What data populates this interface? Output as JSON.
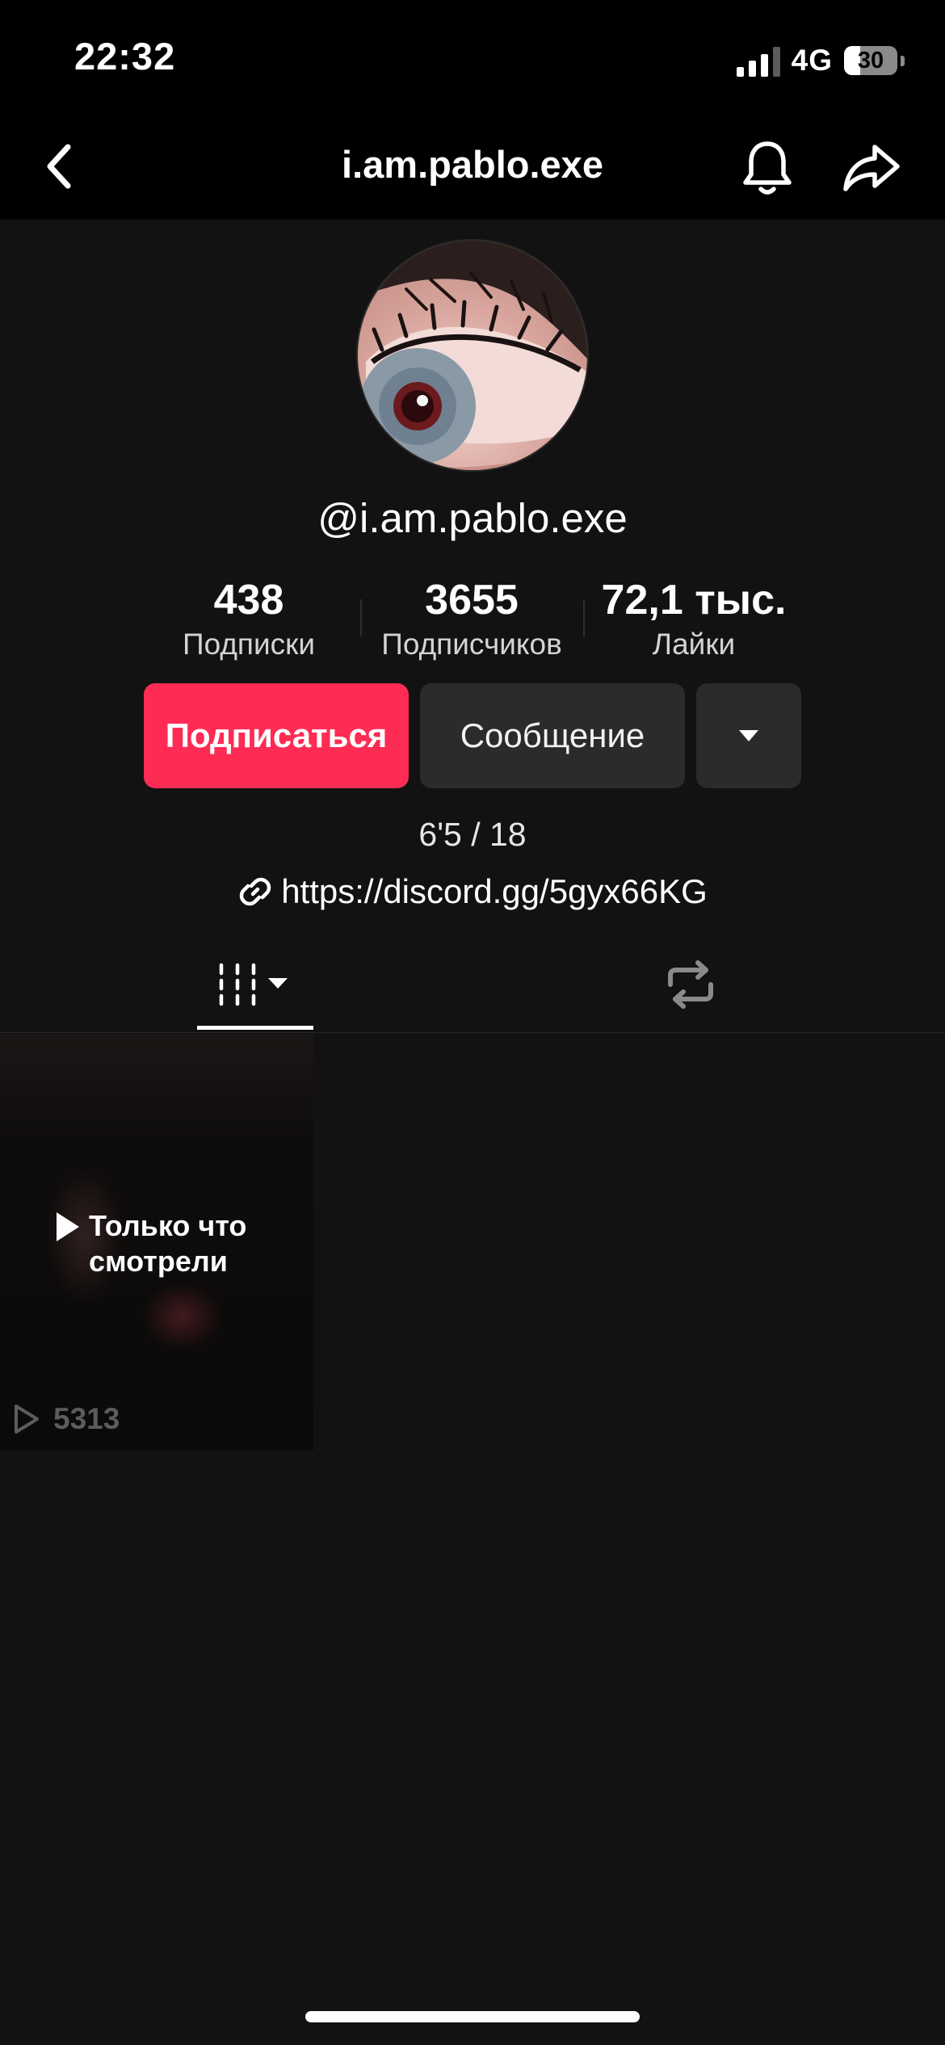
{
  "status_bar": {
    "time": "22:32",
    "network": "4G",
    "battery_level": "30"
  },
  "nav": {
    "title": "i.am.pablo.exe",
    "back_icon": "chevron-left-icon",
    "bell_icon": "bell-icon",
    "share_icon": "share-arrow-icon"
  },
  "profile": {
    "handle": "@i.am.pablo.exe",
    "stats": [
      {
        "value": "438",
        "label": "Подписки"
      },
      {
        "value": "3655",
        "label": "Подписчиков"
      },
      {
        "value": "72,1 тыс.",
        "label": "Лайки"
      }
    ],
    "follow_label": "Подписаться",
    "message_label": "Сообщение",
    "bio": "6'5 / 18",
    "link": "https://discord.gg/5gyx66KG"
  },
  "tabs": {
    "videos_icon": "grid-videos-icon",
    "reposts_icon": "repost-icon"
  },
  "videos": [
    {
      "badge": "Только что смотрели",
      "views": "5313"
    }
  ],
  "colors": {
    "accent": "#fe2c55",
    "background": "#121212",
    "secondary_button": "#2b2b2b"
  }
}
